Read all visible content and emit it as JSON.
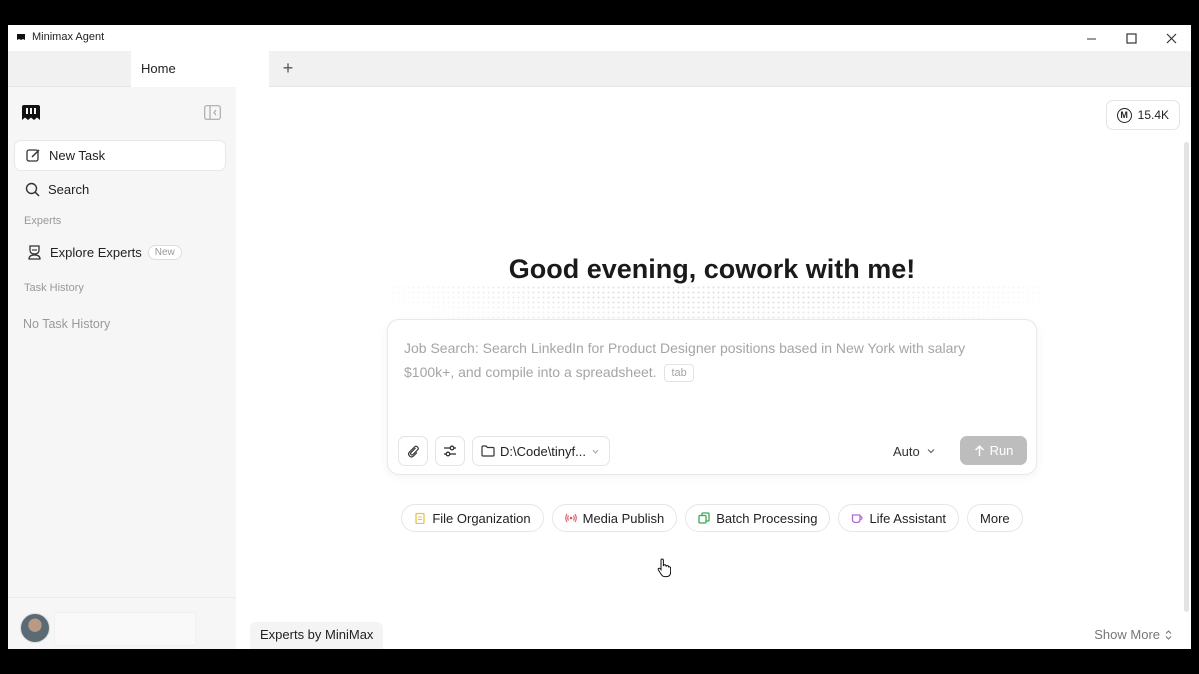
{
  "window": {
    "title": "Minimax Agent"
  },
  "tabs": {
    "home_label": "Home",
    "add_label": "+"
  },
  "sidebar": {
    "new_task": "New Task",
    "search": "Search",
    "experts_section": "Experts",
    "explore_experts": "Explore Experts",
    "new_badge": "New",
    "history_section": "Task History",
    "history_empty": "No Task History"
  },
  "header": {
    "credits": "15.4K",
    "credits_icon_letter": "M"
  },
  "main": {
    "greeting": "Good evening, cowork with me!",
    "prompt_placeholder": "Job Search: Search LinkedIn for Product Designer positions based in New York with salary $100k+, and compile into a spreadsheet.",
    "tab_hint": "tab",
    "folder": "D:\\Code\\tinyf...",
    "mode": "Auto",
    "run_label": "Run",
    "chips": [
      {
        "label": "File Organization",
        "icon": "clipboard-icon",
        "color": "#e6c44a"
      },
      {
        "label": "Media Publish",
        "icon": "broadcast-icon",
        "color": "#e0525a"
      },
      {
        "label": "Batch Processing",
        "icon": "copy-icon",
        "color": "#3aa757"
      },
      {
        "label": "Life Assistant",
        "icon": "cup-icon",
        "color": "#b06ad4"
      },
      {
        "label": "More",
        "icon": "",
        "color": ""
      }
    ],
    "experts_label": "Experts by MiniMax",
    "show_more": "Show More"
  }
}
